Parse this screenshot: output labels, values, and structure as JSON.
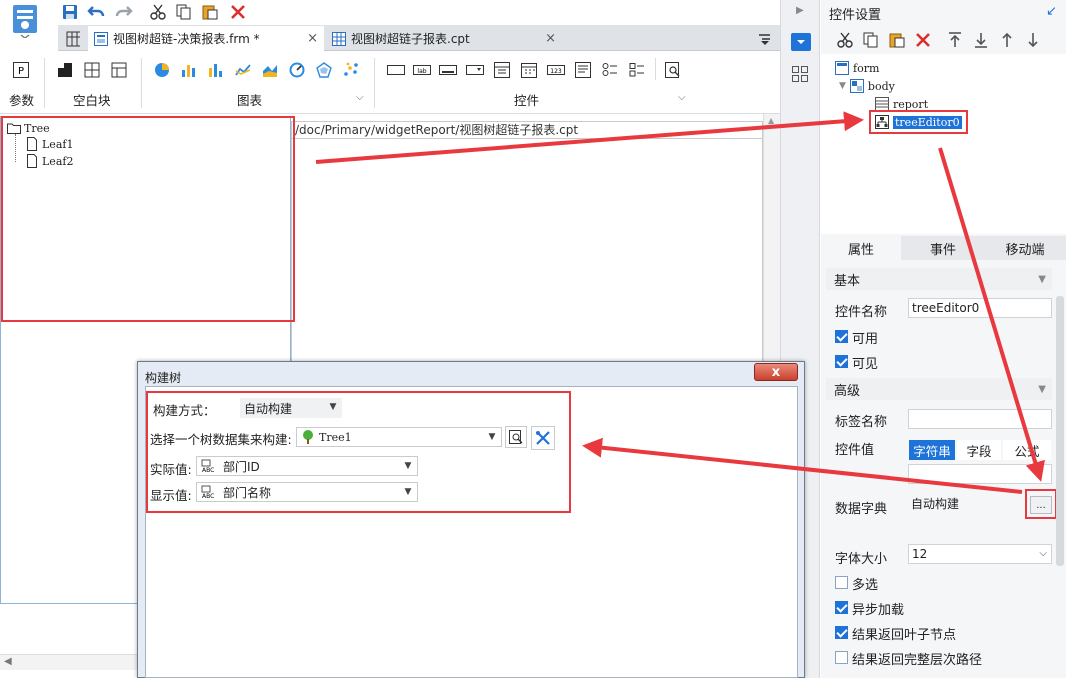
{
  "tabs": [
    {
      "label": "视图树超链-决策报表.frm *",
      "active": true
    },
    {
      "label": "视图树超链子报表.cpt",
      "active": false
    }
  ],
  "palette": {
    "groups": [
      "参数",
      "空白块",
      "图表",
      "控件"
    ]
  },
  "canvas": {
    "report_path": "/doc/Primary/widgetReport/视图树超链子报表.cpt",
    "tree": {
      "root": "Tree",
      "leaves": [
        "Leaf1",
        "Leaf2"
      ]
    }
  },
  "right_panel": {
    "title": "控件设置",
    "component_tree": {
      "form": "form",
      "body": "body",
      "report": "report",
      "selected": "treeEditor0"
    },
    "tabs": [
      "属性",
      "事件",
      "移动端"
    ],
    "sections": {
      "basic": "基本",
      "advanced": "高级"
    },
    "props": {
      "name_label": "控件名称",
      "name_value": "treeEditor0",
      "enabled_label": "可用",
      "visible_label": "可见",
      "tag_label": "标签名称",
      "tag_value": "",
      "value_label": "控件值",
      "value_modes": [
        "字符串",
        "字段",
        "公式"
      ],
      "dict_label": "数据字典",
      "dict_value": "自动构建",
      "dict_btn": "...",
      "font_label": "字体大小",
      "font_value": "12",
      "multi_label": "多选",
      "async_label": "异步加载",
      "leaf_label": "结果返回叶子节点",
      "path_label": "结果返回完整层次路径"
    }
  },
  "dialog": {
    "title": "构建树",
    "mode_label": "构建方式：",
    "mode_value": "自动构建",
    "dataset_label": "选择一个树数据集来构建:",
    "dataset_value": "Tree1",
    "actual_label": "实际值:",
    "actual_value": "部门ID",
    "display_label": "显示值:",
    "display_value": "部门名称",
    "close": "x"
  },
  "colors": {
    "highlight": "#e8393f",
    "accent": "#1e73d8"
  }
}
